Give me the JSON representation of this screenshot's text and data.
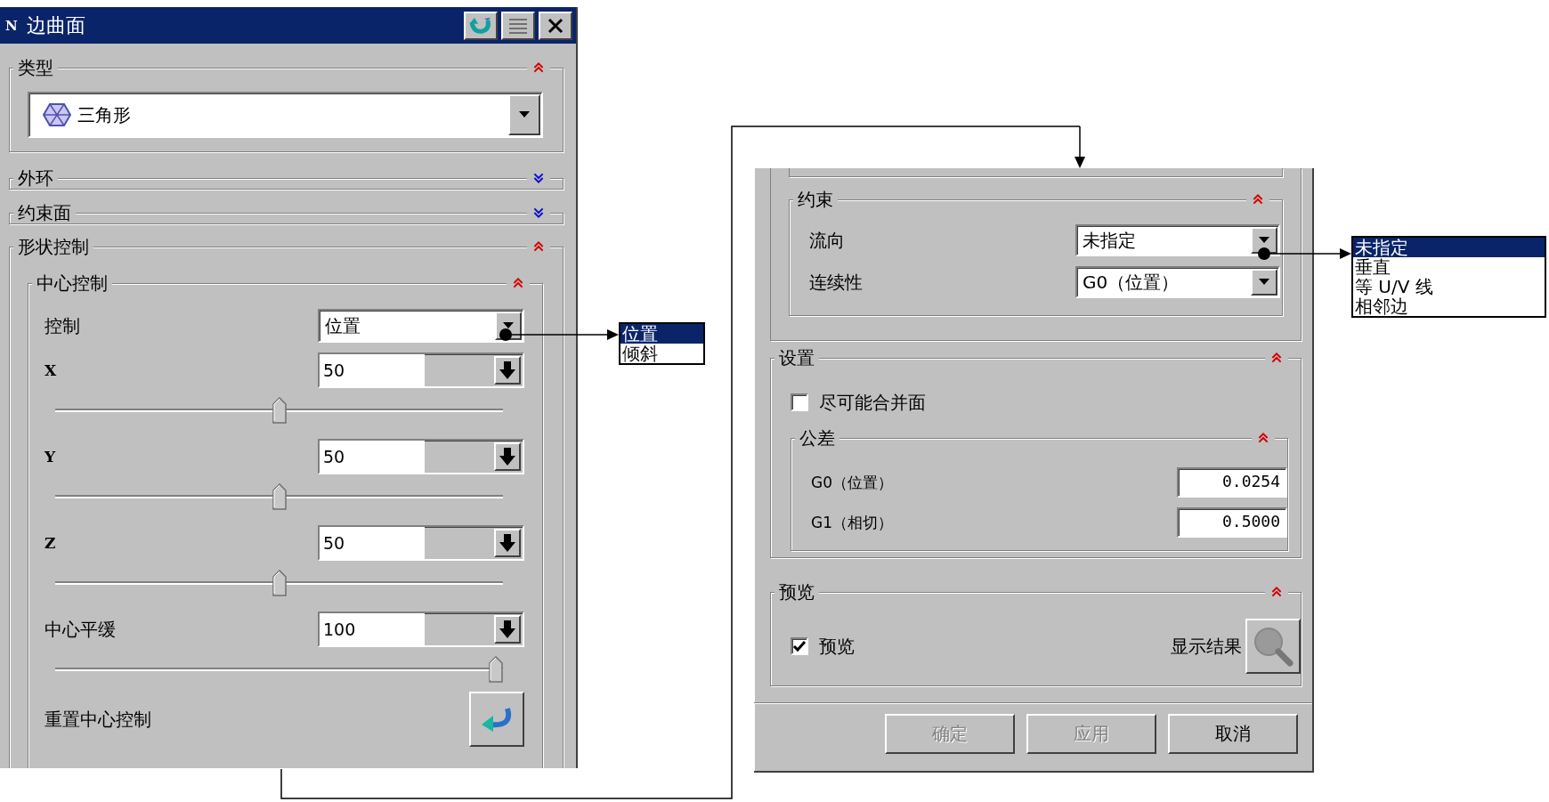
{
  "left_dialog": {
    "badge": "N",
    "title": "边曲面",
    "type_group": {
      "title": "类型",
      "expanded": true,
      "value": "三角形"
    },
    "section_groups": [
      {
        "title": "外环",
        "expanded": false
      },
      {
        "title": "约束面",
        "expanded": false
      }
    ],
    "shape_group": {
      "title": "形状控制",
      "expanded": true
    },
    "center_group": {
      "title": "中心控制",
      "expanded": true,
      "control_label": "控制",
      "control_value": "位置",
      "fields": [
        {
          "label": "X",
          "value": "50",
          "level": 0.5
        },
        {
          "label": "Y",
          "value": "50",
          "level": 0.5
        },
        {
          "label": "Z",
          "value": "50",
          "level": 0.5
        },
        {
          "label": "中心平缓",
          "value": "100",
          "level": 1
        }
      ],
      "reset_label": "重置中心控制"
    }
  },
  "control_popup": {
    "items": [
      {
        "label": "位置",
        "selected": true
      },
      {
        "label": "倾斜",
        "selected": false
      }
    ]
  },
  "right_dialog": {
    "constraint_group": {
      "title": "约束",
      "expanded": true,
      "rows": [
        {
          "label": "流向",
          "value": "未指定"
        },
        {
          "label": "连续性",
          "value": "G0（位置）"
        }
      ]
    },
    "settings_group": {
      "title": "设置",
      "expanded": true,
      "merge_checkbox": {
        "label": "尽可能合并面",
        "checked": false
      },
      "tolerance_group": {
        "title": "公差",
        "expanded": true,
        "rows": [
          {
            "label": "G0（位置）",
            "value": "0.0254"
          },
          {
            "label": "G1（相切）",
            "value": "0.5000"
          }
        ]
      }
    },
    "preview_group": {
      "title": "预览",
      "expanded": true,
      "preview_checkbox": {
        "label": "预览",
        "checked": true
      },
      "show_result_label": "显示结果"
    },
    "buttons": [
      {
        "label": "确定",
        "disabled": true
      },
      {
        "label": "应用",
        "disabled": true
      },
      {
        "label": "取消",
        "disabled": false
      }
    ]
  },
  "direction_popup": {
    "items": [
      {
        "label": "未指定",
        "selected": true
      },
      {
        "label": "垂直",
        "selected": false
      },
      {
        "label": "等 U/V 线",
        "selected": false
      },
      {
        "label": "相邻边",
        "selected": false
      }
    ]
  }
}
